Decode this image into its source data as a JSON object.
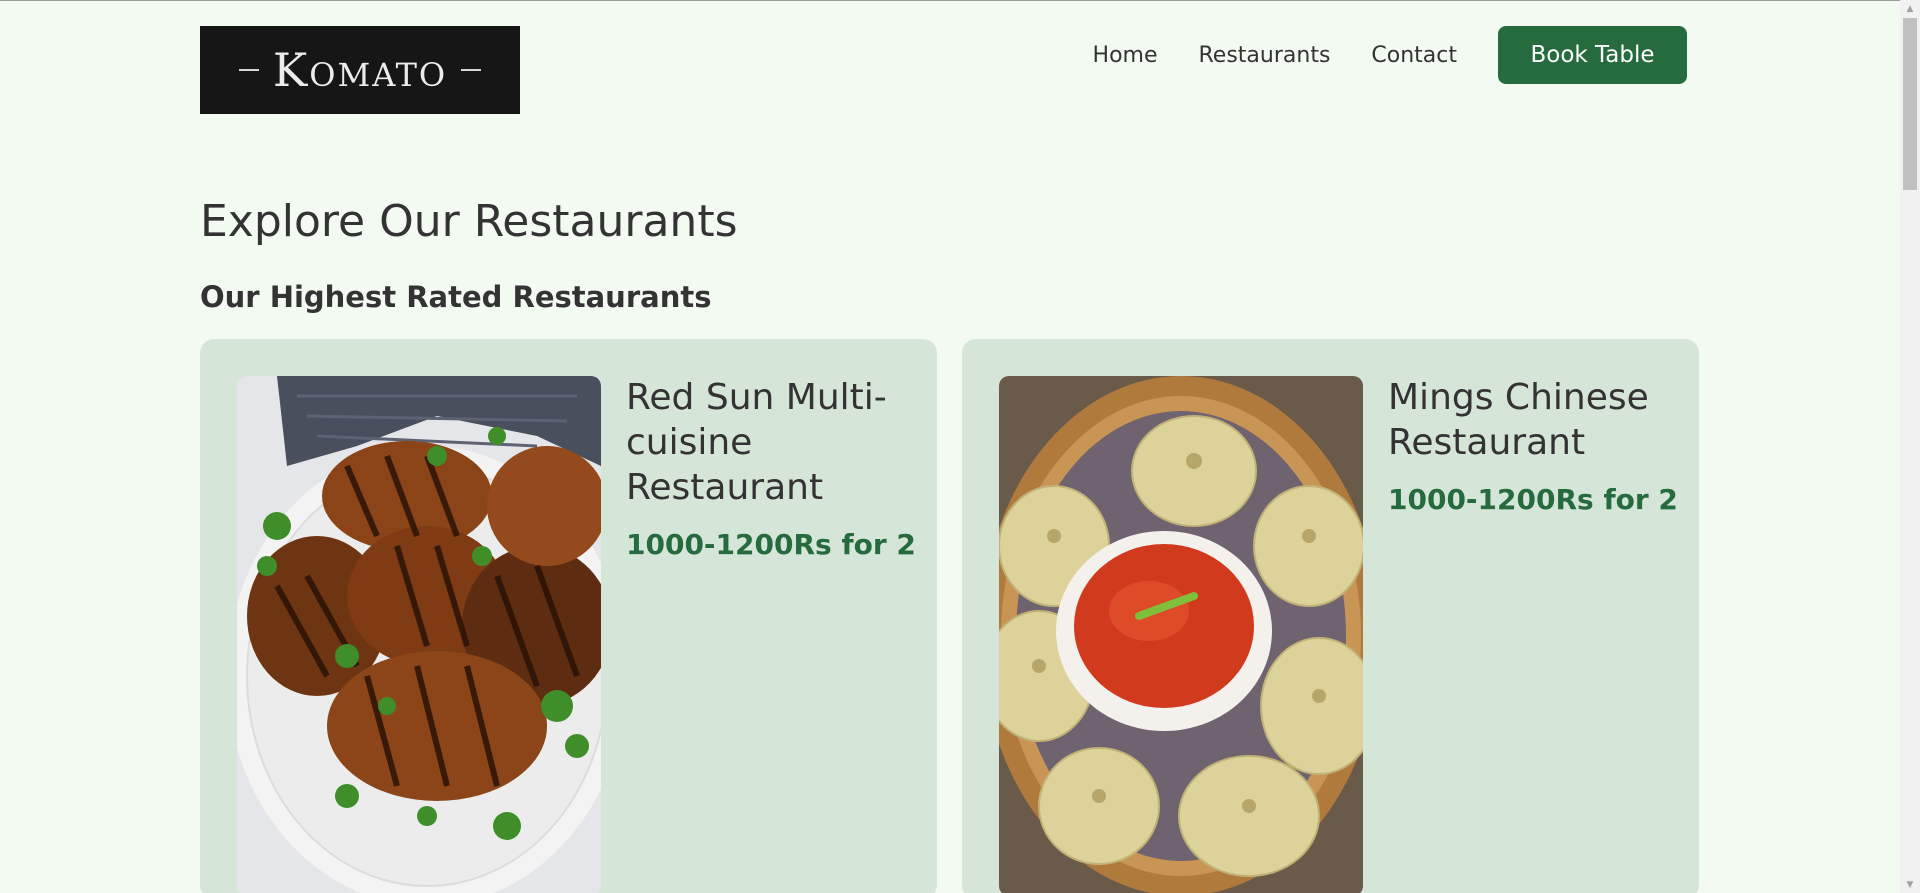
{
  "header": {
    "logo_text": "Komato",
    "nav": [
      {
        "label": "Home"
      },
      {
        "label": "Restaurants"
      },
      {
        "label": "Contact"
      }
    ],
    "cta_label": "Book Table"
  },
  "main": {
    "title": "Explore Our Restaurants",
    "subtitle": "Our Highest Rated Restaurants",
    "restaurants": [
      {
        "name": "Red Sun Multi-cuisine Restaurant",
        "price": "1000-1200Rs for 2",
        "image": "grilled-chicken-photo"
      },
      {
        "name": "Mings Chinese Restaurant",
        "price": "1000-1200Rs for 2",
        "image": "momos-photo"
      }
    ]
  },
  "colors": {
    "background": "#f3faf2",
    "accent": "#256b3e",
    "card": "#d5e5d8"
  }
}
